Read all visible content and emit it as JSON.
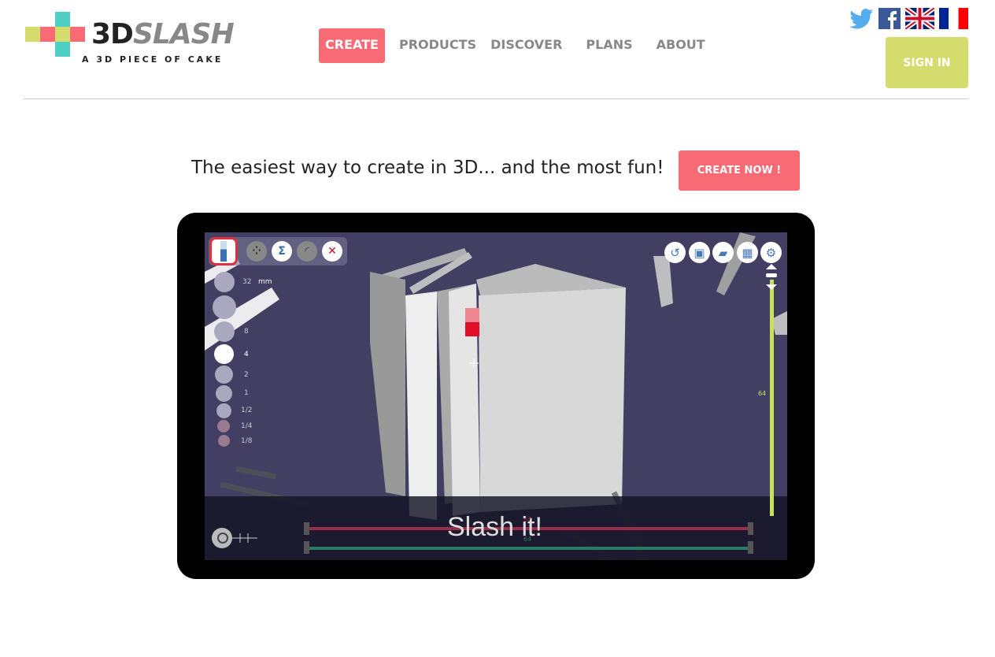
{
  "logo": {
    "brand_bold": "3D",
    "brand_light": "SLASH",
    "tagline": "A 3D PIECE OF CAKE",
    "colors": [
      "#d3dc6c",
      "#f86b74",
      "#4fcfc6"
    ]
  },
  "nav": {
    "items": [
      {
        "label": "CREATE",
        "active": true
      },
      {
        "label": "PRODUCTS"
      },
      {
        "label": "DISCOVER"
      },
      {
        "label": "PLANS"
      },
      {
        "label": "ABOUT"
      }
    ]
  },
  "social": {
    "icons": [
      "twitter-icon",
      "facebook-icon",
      "uk-flag-icon",
      "france-flag-icon"
    ]
  },
  "signin": {
    "label": "SIGN IN",
    "color": "#d3dc6c"
  },
  "hero": {
    "text": "The easiest way to create in 3D... and the most fun!",
    "cta": "CREATE NOW !",
    "cta_color": "#f86b74"
  },
  "app": {
    "tools": [
      "hammer-icon",
      "dots-icon",
      "zigzag-icon",
      "curve-icon",
      "close-icon"
    ],
    "unit": "mm",
    "sizes": [
      "32",
      "8",
      "4",
      "2",
      "1",
      "1/2",
      "1/4",
      "1/8"
    ],
    "selected_size": "4",
    "right_tools": [
      "undo-icon",
      "save-icon",
      "folder-icon",
      "grid-icon",
      "gear-icon"
    ],
    "vertical_value": "64",
    "red_value": "64",
    "green_value": "64",
    "overlay": "Slash it!"
  }
}
